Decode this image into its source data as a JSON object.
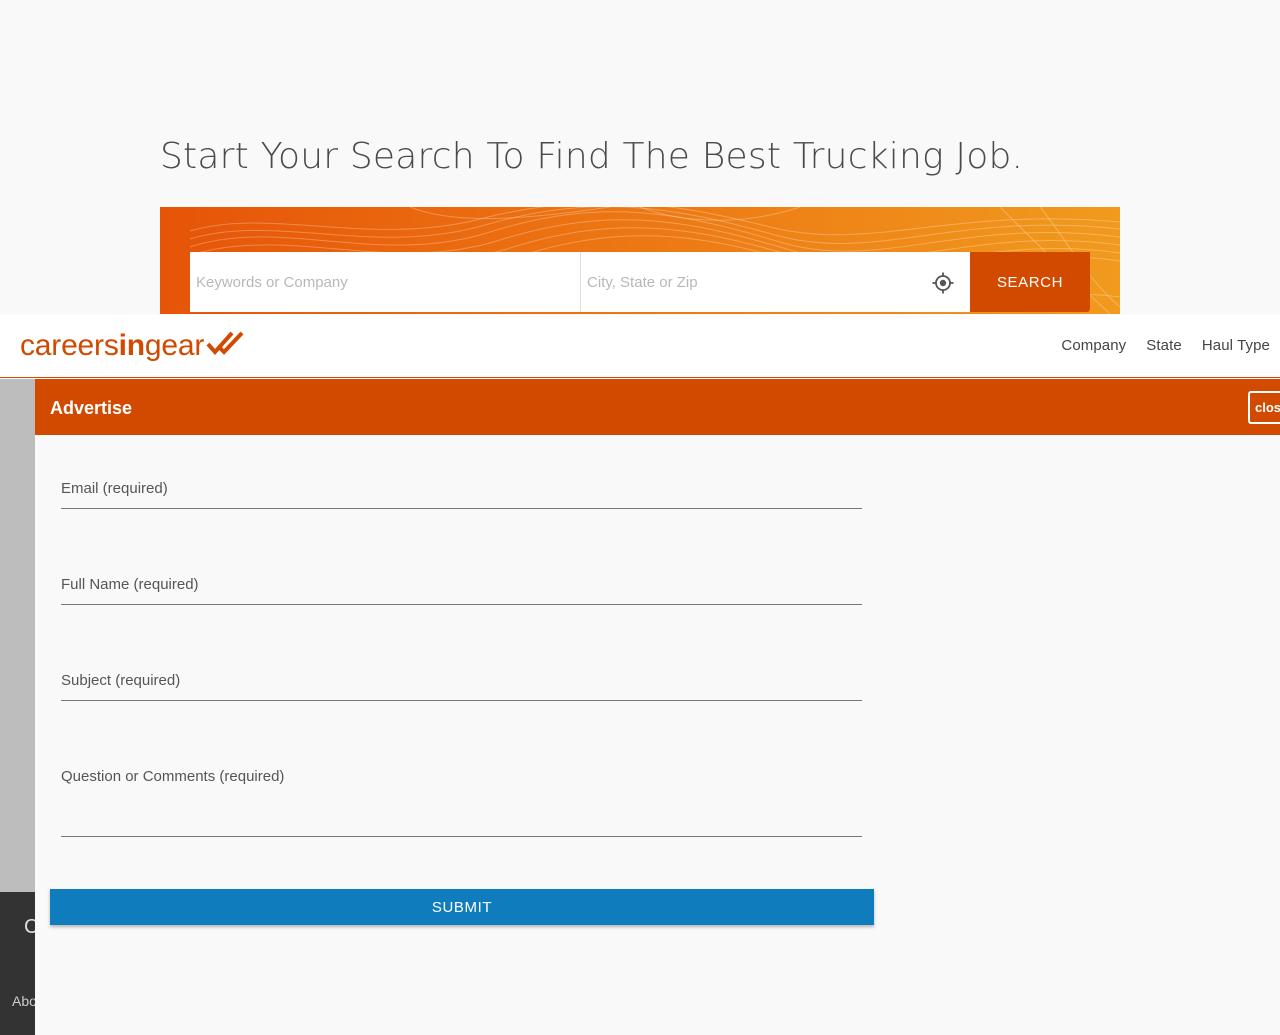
{
  "hero": {
    "title": "Start Your Search To Find The Best Trucking Job."
  },
  "search": {
    "keywords_placeholder": "Keywords or Company",
    "location_placeholder": "City, State or Zip",
    "button_label": "SEARCH"
  },
  "header": {
    "logo_text_light": "careers",
    "logo_text_bold": "in",
    "logo_text_end": "gear",
    "nav": [
      "Company",
      "State",
      "Haul Type"
    ]
  },
  "background_fragments": {
    "side_letter": "C",
    "side_about": "Abo"
  },
  "modal": {
    "title": "Advertise",
    "close_label": "clos",
    "fields": {
      "email_label": "Email (required)",
      "email_value": "",
      "name_label": "Full Name (required)",
      "name_value": "",
      "subject_label": "Subject (required)",
      "subject_value": "",
      "comments_label": "Question or Comments (required)",
      "comments_value": ""
    },
    "submit_label": "SUBMIT"
  },
  "colors": {
    "brand_orange": "#d24a00",
    "banner_gradient_start": "#e65408",
    "banner_gradient_end": "#f19a1e",
    "submit_blue": "#0f7dbd"
  },
  "icons": {
    "locate": "crosshair-target-icon",
    "logo_mark": "double-check-icon"
  }
}
